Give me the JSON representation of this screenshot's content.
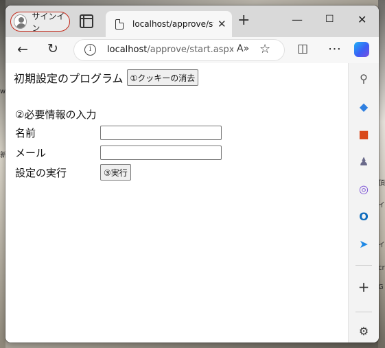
{
  "window": {
    "signin_label": "サインイン",
    "tab_title": "localhost/approve/start.aspx",
    "tab_close": "✕",
    "new_tab": "+",
    "controls": {
      "minimize": "—",
      "maximize": "☐",
      "close": "✕"
    }
  },
  "toolbar": {
    "back": "←",
    "refresh": "↻",
    "url_host": "localhost",
    "url_path": "/approve/start.aspx",
    "read_aloud": "A»",
    "favorite": "☆",
    "split": "◫",
    "more": "⋯"
  },
  "page": {
    "title": "初期設定のプログラム",
    "clear_cookie_button": "①クッキーの消去",
    "section_title": "②必要情報の入力",
    "name_label": "名前",
    "name_value": "",
    "mail_label": "メール",
    "mail_value": "",
    "run_label": "設定の実行",
    "run_button": "③実行"
  },
  "sidebar": {
    "items": [
      {
        "icon": "search-icon",
        "glyph": "⚲",
        "color": "#555555"
      },
      {
        "icon": "tag-icon",
        "glyph": "◆",
        "color": "#2f7fe0"
      },
      {
        "icon": "toolbox-icon",
        "glyph": "■",
        "color": "#d9491b"
      },
      {
        "icon": "person-icon",
        "glyph": "♟",
        "color": "#6a6a8a"
      },
      {
        "icon": "office-icon",
        "glyph": "◎",
        "color": "#7a4fd6"
      },
      {
        "icon": "outlook-icon",
        "glyph": "O",
        "color": "#0f6cbd"
      },
      {
        "icon": "send-icon",
        "glyph": "➤",
        "color": "#1e88e5"
      }
    ],
    "add": "+",
    "settings": "⚙"
  },
  "background": {
    "left_fragments": [
      "w",
      "新"
    ],
    "right_fragments": [
      "頂",
      "イ",
      "イ",
      "cro",
      "G"
    ]
  },
  "colors": {
    "signin_border": "#c42b1c",
    "tabstrip": "#d9d9d9",
    "toolbar": "#f7f7f7",
    "page_bg": "#ffffff"
  }
}
